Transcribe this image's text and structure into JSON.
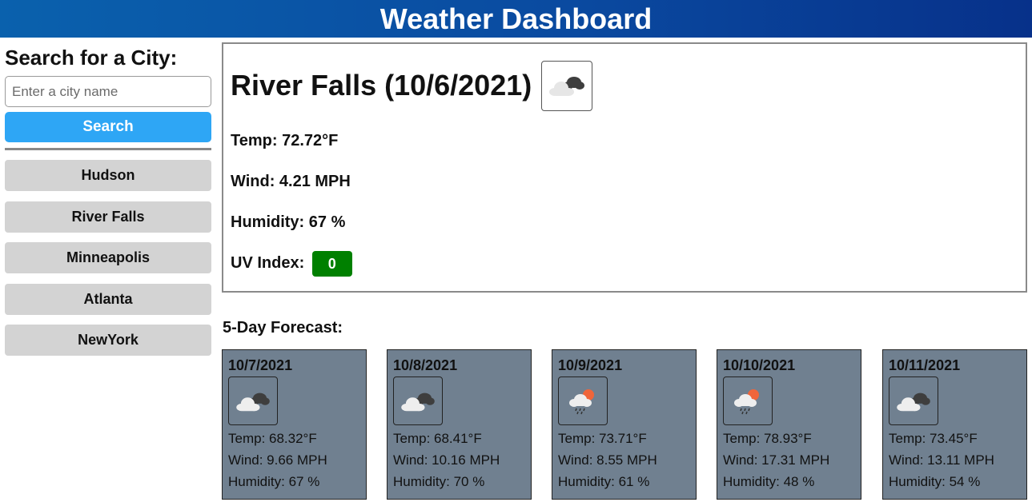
{
  "header": {
    "title": "Weather Dashboard"
  },
  "sidebar": {
    "heading": "Search for a City:",
    "input_placeholder": "Enter a city name",
    "search_label": "Search",
    "history": [
      "Hudson",
      "River Falls",
      "Minneapolis",
      "Atlanta",
      "NewYork"
    ]
  },
  "current": {
    "title": "River Falls (10/6/2021)",
    "icon": "broken-clouds-icon",
    "temp": "Temp: 72.72°F",
    "wind": "Wind: 4.21 MPH",
    "humidity": "Humidity: 67 %",
    "uv_label": "UV Index:",
    "uv_value": "0",
    "uv_color": "#008000"
  },
  "forecast": {
    "heading": "5-Day Forecast:",
    "days": [
      {
        "date": "10/7/2021",
        "icon": "broken-clouds-icon",
        "temp": "Temp: 68.32°F",
        "wind": "Wind: 9.66 MPH",
        "humidity": "Humidity: 67 %"
      },
      {
        "date": "10/8/2021",
        "icon": "broken-clouds-icon",
        "temp": "Temp: 68.41°F",
        "wind": "Wind: 10.16 MPH",
        "humidity": "Humidity: 70 %"
      },
      {
        "date": "10/9/2021",
        "icon": "rain-sun-icon",
        "temp": "Temp: 73.71°F",
        "wind": "Wind: 8.55 MPH",
        "humidity": "Humidity: 61 %"
      },
      {
        "date": "10/10/2021",
        "icon": "rain-sun-icon",
        "temp": "Temp: 78.93°F",
        "wind": "Wind: 17.31 MPH",
        "humidity": "Humidity: 48 %"
      },
      {
        "date": "10/11/2021",
        "icon": "broken-clouds-icon",
        "temp": "Temp: 73.45°F",
        "wind": "Wind: 13.11 MPH",
        "humidity": "Humidity: 54 %"
      }
    ]
  },
  "colors": {
    "header_gradient_start": "#0a61ad",
    "header_gradient_end": "#07318a",
    "search_button": "#2ea6f5",
    "history_button": "#d3d3d3",
    "forecast_card": "#708090"
  }
}
